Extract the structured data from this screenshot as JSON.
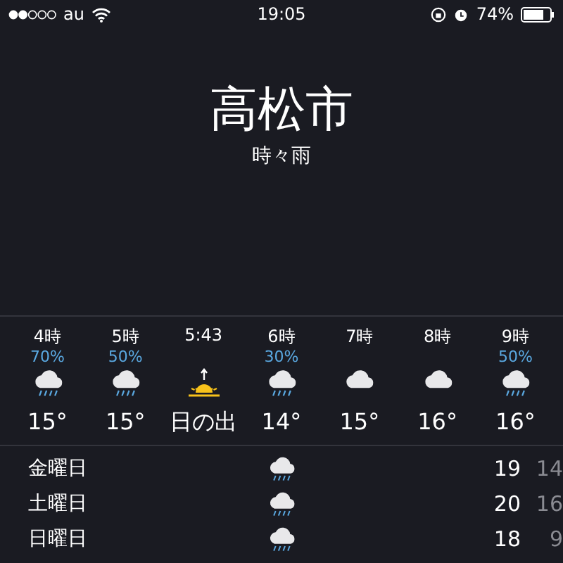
{
  "status_bar": {
    "carrier": "au",
    "time": "19:05",
    "battery": "74%"
  },
  "location": {
    "city": "高松市",
    "condition": "時々雨"
  },
  "hourly": [
    {
      "time": "4時",
      "precip": "70%",
      "kind": "rain",
      "temp": "15°"
    },
    {
      "time": "5時",
      "precip": "50%",
      "kind": "rain",
      "temp": "15°"
    },
    {
      "time": "5:43",
      "kind": "sunrise",
      "temp": "日の出"
    },
    {
      "time": "6時",
      "precip": "30%",
      "kind": "rain",
      "temp": "14°"
    },
    {
      "time": "7時",
      "kind": "cloud",
      "temp": "15°"
    },
    {
      "time": "8時",
      "kind": "cloud",
      "temp": "16°"
    },
    {
      "time": "9時",
      "precip": "50%",
      "kind": "rain",
      "temp": "16°"
    }
  ],
  "daily": [
    {
      "day": "金曜日",
      "kind": "rain",
      "high": "19",
      "low": "14"
    },
    {
      "day": "土曜日",
      "kind": "rain",
      "high": "20",
      "low": "16"
    },
    {
      "day": "日曜日",
      "kind": "rain",
      "high": "18",
      "low": "9"
    }
  ]
}
